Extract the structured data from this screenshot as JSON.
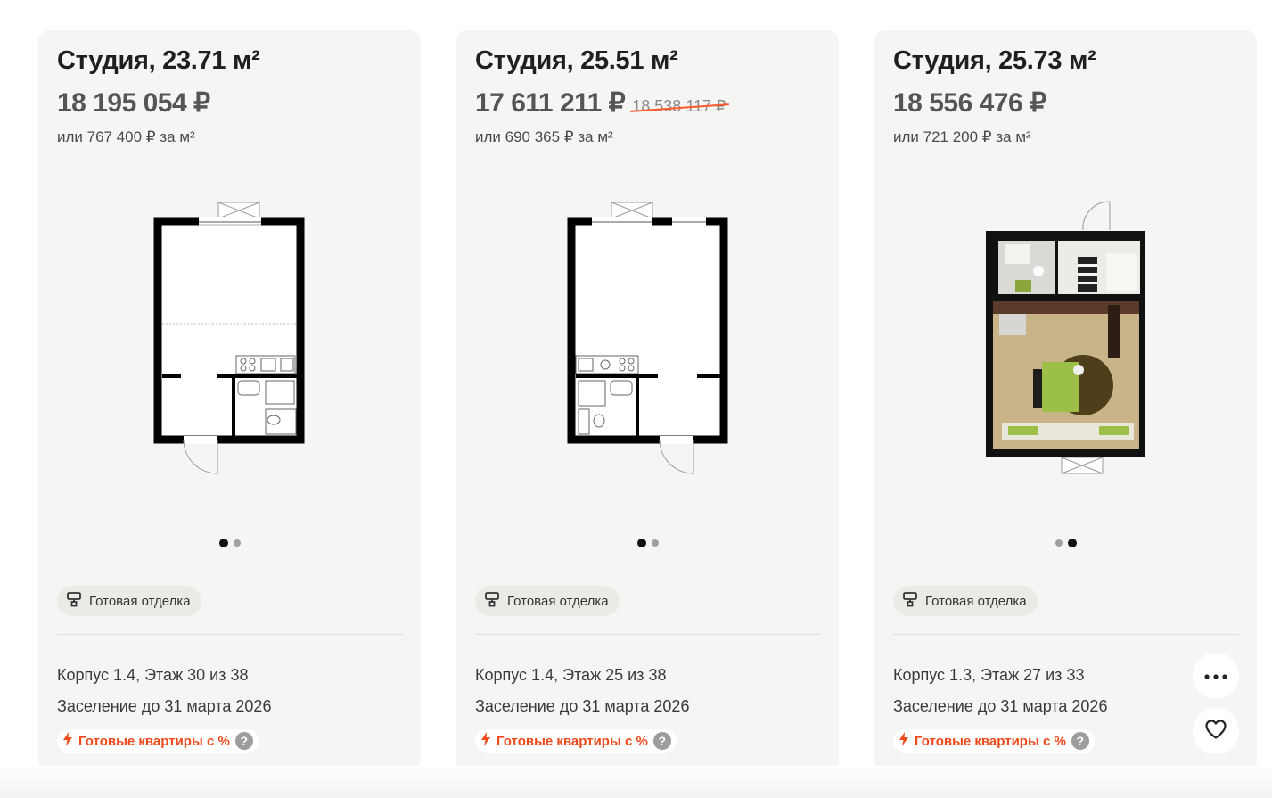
{
  "cards": [
    {
      "title": "Студия, 23.71 м²",
      "price": "18 195 054 ₽",
      "old_price": "",
      "price_per_m": "или 767 400 ₽ за м²",
      "slides_total": 2,
      "slide_active": 1,
      "finish": "Готовая отделка",
      "building": "Корпус 1.4, Этаж 30 из 38",
      "settlement": "Заселение до 31 марта 2026",
      "promo": "Готовые квартиры с %"
    },
    {
      "title": "Студия, 25.51 м²",
      "price": "17 611 211 ₽",
      "old_price": "18 538 117 ₽",
      "price_per_m": "или 690 365 ₽ за м²",
      "slides_total": 2,
      "slide_active": 1,
      "finish": "Готовая отделка",
      "building": "Корпус 1.4, Этаж 25 из 38",
      "settlement": "Заселение до 31 марта 2026",
      "promo": "Готовые квартиры с %"
    },
    {
      "title": "Студия, 25.73 м²",
      "price": "18 556 476 ₽",
      "old_price": "",
      "price_per_m": "или 721 200 ₽ за м²",
      "slides_total": 2,
      "slide_active": 2,
      "finish": "Готовая отделка",
      "building": "Корпус 1.3, Этаж 27 из 33",
      "settlement": "Заселение до 31 марта 2026",
      "promo": "Готовые квартиры с %"
    }
  ],
  "icons": {
    "finish": "paint-roller-icon",
    "promo": "lightning-icon",
    "help": "question-icon",
    "help_glyph": "?",
    "more": "more-dots-icon",
    "favorite": "heart-icon"
  },
  "colors": {
    "card_bg": "#f5f5f3",
    "promo_accent": "#ee4a1b",
    "price": "#555555"
  }
}
